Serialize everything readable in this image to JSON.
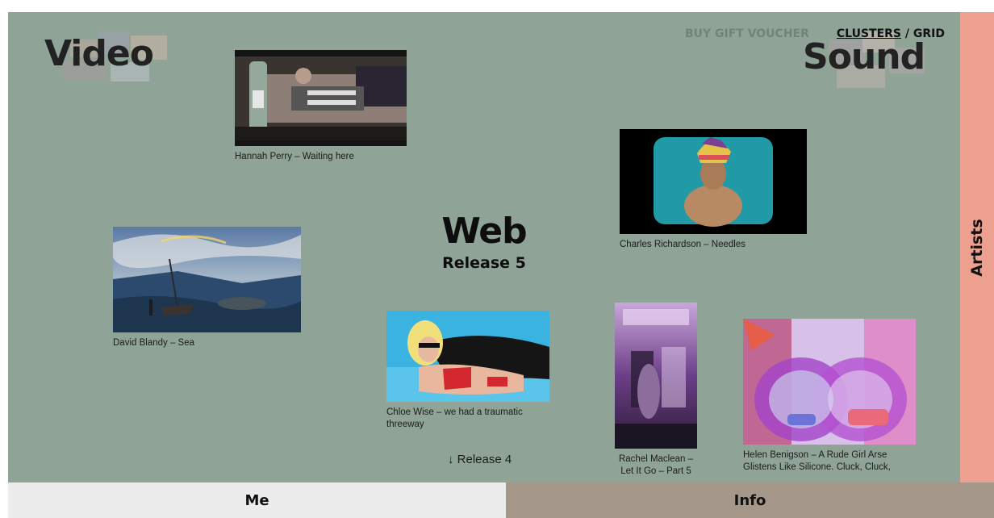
{
  "header": {
    "video": "Video",
    "sound": "Sound",
    "gift_voucher": "BUY GIFT VOUCHER",
    "view_clusters": "CLUSTERS",
    "view_separator": "/",
    "view_grid": "GRID"
  },
  "center": {
    "title": "Web",
    "subtitle": "Release 5",
    "previous_release": "↓ Release 4"
  },
  "works": [
    {
      "caption": "Hannah Perry – Waiting here"
    },
    {
      "caption": "Charles Richardson – Needles"
    },
    {
      "caption": "David Blandy – Sea"
    },
    {
      "caption": "Chloe Wise – we had a traumatic threeway"
    },
    {
      "caption": "Rachel Maclean – Let It Go – Part 5"
    },
    {
      "caption": "Helen Benigson – A Rude Girl Arse Glistens Like Silicone. Cluck, Cluck,"
    }
  ],
  "sidebar": {
    "label": "Artists"
  },
  "bottom_tabs": {
    "me": "Me",
    "info": "Info"
  },
  "colors": {
    "background": "#8fa397",
    "sidebar": "#eda08f",
    "tab_me": "#ececec",
    "tab_info": "#a59789"
  }
}
